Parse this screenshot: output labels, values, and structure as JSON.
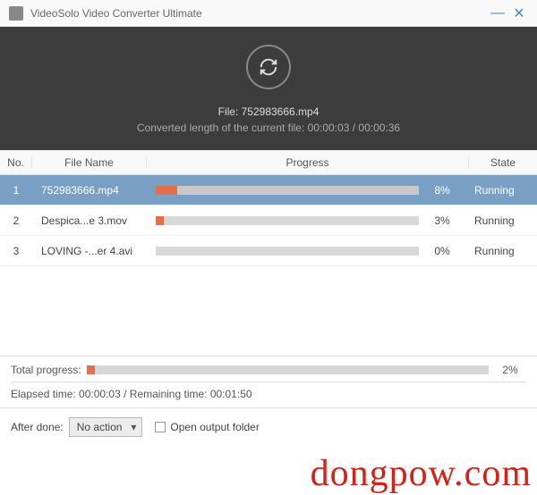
{
  "titlebar": {
    "title": "VideoSolo Video Converter Ultimate",
    "min": "—",
    "close": "✕"
  },
  "header": {
    "file_prefix": "File: ",
    "file_name": "752983666.mp4",
    "conv_prefix": "Converted length of the current file: ",
    "conv_elapsed": "00:00:03",
    "conv_sep": " / ",
    "conv_total": "00:00:36"
  },
  "columns": {
    "no": "No.",
    "file": "File Name",
    "progress": "Progress",
    "state": "State"
  },
  "rows": [
    {
      "no": "1",
      "file": "752983666.mp4",
      "pct": "8%",
      "pctw": "8%",
      "state": "Running",
      "selected": true
    },
    {
      "no": "2",
      "file": "Despica...e 3.mov",
      "pct": "3%",
      "pctw": "3%",
      "state": "Running",
      "selected": false
    },
    {
      "no": "3",
      "file": "LOVING -...er 4.avi",
      "pct": "0%",
      "pctw": "0%",
      "state": "Running",
      "selected": false
    }
  ],
  "totals": {
    "label": "Total progress:",
    "pct": "2%",
    "pctw": "2%",
    "elapsed_label": "Elapsed time: ",
    "elapsed": "00:00:03",
    "sep": " / ",
    "remain_label": "Remaining time: ",
    "remain": "00:01:50"
  },
  "footer": {
    "after_label": "After done:",
    "after_value": "No action",
    "open_folder": "Open output folder"
  },
  "watermark": "dongpow.com"
}
